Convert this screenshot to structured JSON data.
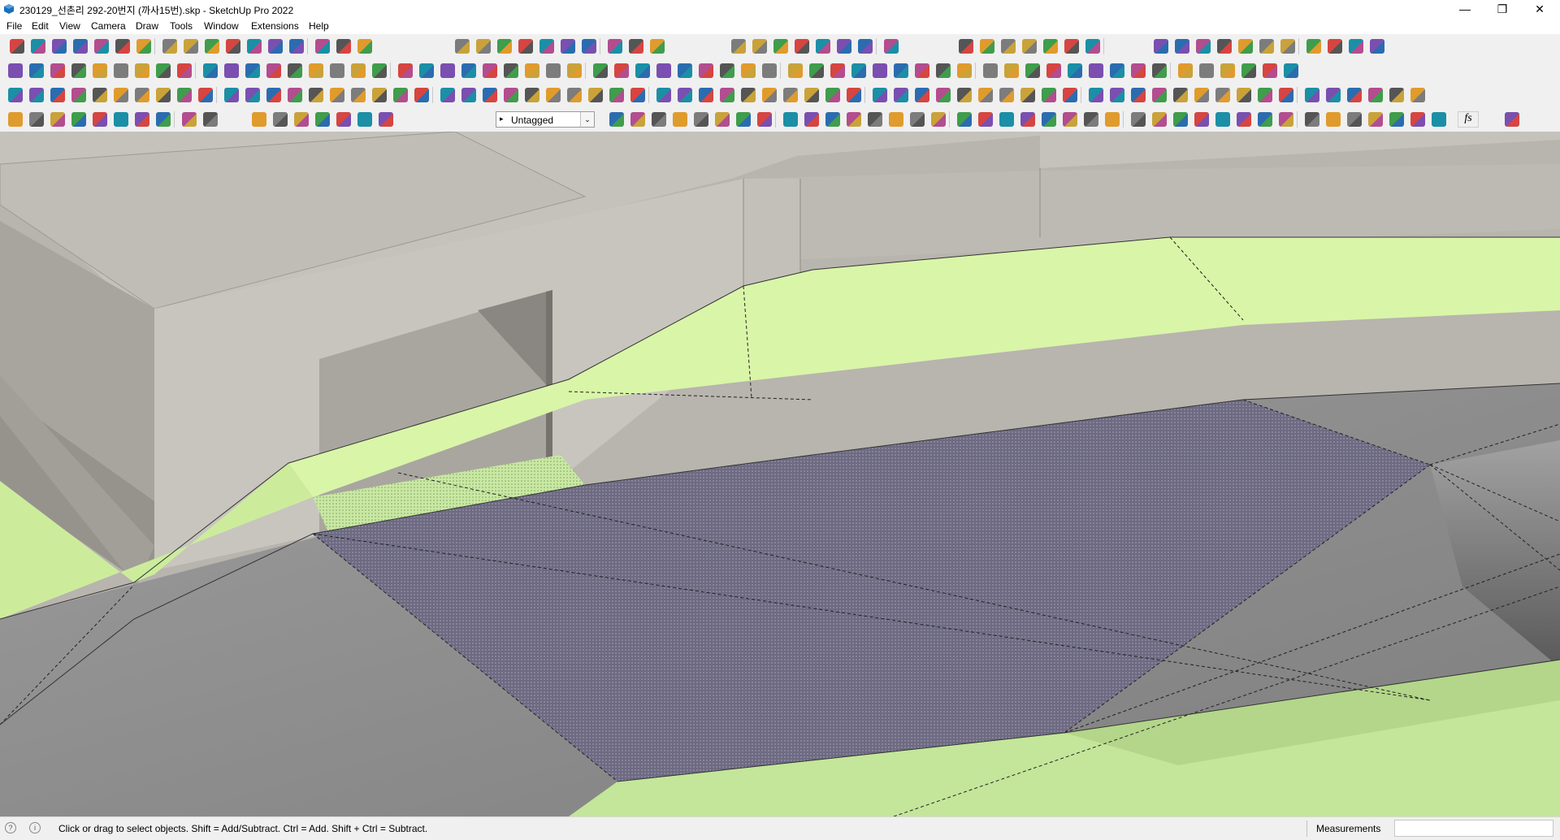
{
  "window": {
    "title": "230129_선촌리 292-20번지 (까사15번).skp - SketchUp Pro 2022",
    "minimize_glyph": "—",
    "restore_glyph": "❐",
    "close_glyph": "✕"
  },
  "menu": [
    "File",
    "Edit",
    "View",
    "Camera",
    "Draw",
    "Tools",
    "Window",
    "Extensions",
    "Help"
  ],
  "toolbar": {
    "tag_selector": {
      "value": "Untagged",
      "arrow": "▸",
      "chevron": "⌄"
    },
    "fs_label": "fs"
  },
  "statusbar": {
    "geo_icon_glyph": "?",
    "info_icon_glyph": "i",
    "hint": "Click or drag to select objects. Shift = Add/Subtract. Ctrl = Add. Shift + Ctrl = Subtract.",
    "measurements_label": "Measurements",
    "measurements_value": ""
  },
  "colors": {
    "sky": "#b8b4ae",
    "wall": "#c7c4be",
    "wall_dark": "#a8a59f",
    "grass": "#d9f5a8",
    "grass_dark": "#b4d98c",
    "ground": "#8d8d8d",
    "selected_face": "#6d6a82"
  }
}
